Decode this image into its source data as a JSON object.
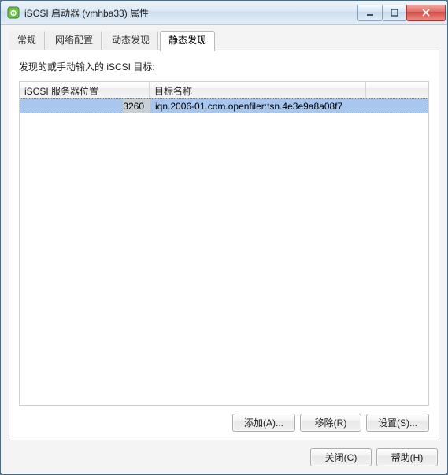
{
  "window": {
    "title": "iSCSI 启动器 (vmhba33) 属性"
  },
  "tabs": [
    "常规",
    "网络配置",
    "动态发现",
    "静态发现"
  ],
  "activeTab": 3,
  "page": {
    "label": "发现的或手动输入的 iSCSI 目标:",
    "columns": [
      "iSCSI 服务器位置",
      "目标名称",
      ""
    ],
    "rows": [
      {
        "port": "3260",
        "target": "iqn.2006-01.com.openfiler:tsn.4e3e9a8a08f7"
      }
    ],
    "buttons": {
      "add": "添加(A)...",
      "remove": "移除(R)",
      "settings": "设置(S)..."
    }
  },
  "dialogButtons": {
    "close": "关闭(C)",
    "help": "帮助(H)"
  }
}
